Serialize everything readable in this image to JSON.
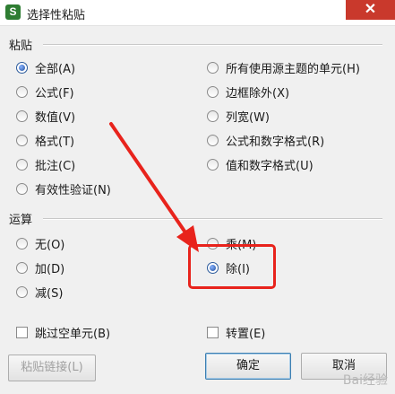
{
  "window": {
    "title": "选择性粘贴",
    "app_icon": "S",
    "close_glyph": "✕"
  },
  "paste_group": {
    "label": "粘贴",
    "options": [
      {
        "label": "全部(A)",
        "checked": true
      },
      {
        "label": "公式(F)",
        "checked": false
      },
      {
        "label": "数值(V)",
        "checked": false
      },
      {
        "label": "格式(T)",
        "checked": false
      },
      {
        "label": "批注(C)",
        "checked": false
      },
      {
        "label": "有效性验证(N)",
        "checked": false
      },
      {
        "label": "所有使用源主题的单元(H)",
        "checked": false
      },
      {
        "label": "边框除外(X)",
        "checked": false
      },
      {
        "label": "列宽(W)",
        "checked": false
      },
      {
        "label": "公式和数字格式(R)",
        "checked": false
      },
      {
        "label": "值和数字格式(U)",
        "checked": false
      }
    ]
  },
  "operation_group": {
    "label": "运算",
    "options": [
      {
        "label": "无(O)",
        "checked": false
      },
      {
        "label": "加(D)",
        "checked": false
      },
      {
        "label": "减(S)",
        "checked": false
      },
      {
        "label": "乘(M)",
        "checked": false
      },
      {
        "label": "除(I)",
        "checked": true
      }
    ]
  },
  "checkboxes": {
    "skip_blanks": "跳过空单元(B)",
    "transpose": "转置(E)"
  },
  "buttons": {
    "paste_link": "粘贴链接(L)",
    "ok": "确定",
    "cancel": "取消"
  },
  "watermark": "Bai经验",
  "colors": {
    "annotation_red": "#e8231c",
    "close_red": "#c9392c"
  }
}
